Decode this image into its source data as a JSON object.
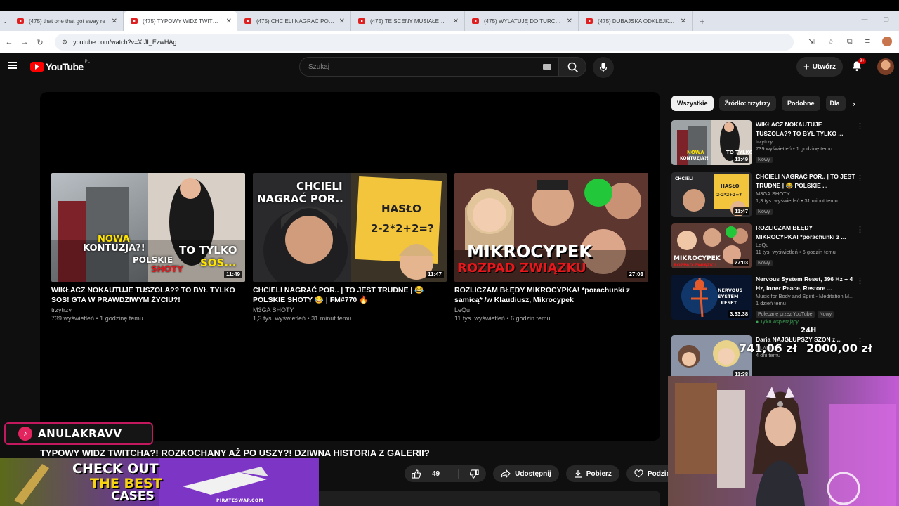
{
  "browser": {
    "tabs": [
      {
        "title": "(475) that one that got away re"
      },
      {
        "title": "(475) TYPOWY WIDZ TWITCHA"
      },
      {
        "title": "(475) CHCIELI NAGRAĆ POR.. |"
      },
      {
        "title": "(475) TE SCENY MUSIAŁEM WY"
      },
      {
        "title": "(475) WYLATUJĘ DO TURCJI - Y"
      },
      {
        "title": "(475) DUBAJSKA ODKLEJKA WI"
      }
    ],
    "url": "youtube.com/watch?v=XIJI_EzwHAg"
  },
  "youtube": {
    "logo_word": "YouTube",
    "logo_country": "PL",
    "search_placeholder": "Szukaj",
    "create_label": "Utwórz",
    "notif_count": "9+"
  },
  "endscreen": [
    {
      "title": "WIKŁACZ NOKAUTUJE TUSZOLA?? TO BYŁ TYLKO SOS! GTA W PRAWDZIWYM ŻYCIU?!",
      "channel": "trzytrzy",
      "meta": "739 wyświetleń • 1 godzinę temu",
      "duration": "11:49",
      "overlay": {
        "l1": "NOWA",
        "l2": "KONTUZJA?!",
        "l3": "POLSKIE",
        "l4": "SHOTY",
        "l5": "TO TYLKO",
        "l6": "SOS..."
      }
    },
    {
      "title": "CHCIELI NAGRAĆ POR.. | TO JEST TRUDNE | 😂 POLSKIE SHOTY 😂 | FM#770 🔥",
      "channel": "M3GA SHOTY",
      "meta": "1,3 tys. wyświetleń • 31 minut temu",
      "duration": "11:47",
      "overlay": {
        "l1": "CHCIELI",
        "l2": "NAGRAĆ POR..",
        "l3": "HASŁO",
        "l4": "2-2*2+2=?"
      }
    },
    {
      "title": "ROZLICZAM BŁĘDY MIKROCYPKA! *porachunki z samicą* /w Klaudiusz, Mikrocypek",
      "channel": "LeQu",
      "meta": "11 tys. wyświetleń • 6 godzin temu",
      "duration": "27:03",
      "overlay": {
        "l1": "MIKROCYPEK",
        "l2": "ROZPAD ZWIĄZKU"
      }
    }
  ],
  "video": {
    "title": "TYPOWY WIDZ TWITCHA?! ROZKOCHANY AŻ PO USZY?! DZIWNA HISTORIA Z GALERII?",
    "likes": "49",
    "share": "Udostępnij",
    "download": "Pobierz",
    "thanks": "Podziękuj"
  },
  "sidebar": {
    "chips": [
      "Wszystkie",
      "Źródło: trzytrzy",
      "Podobne",
      "Dla"
    ],
    "items": [
      {
        "title": "WIKŁACZ NOKAUTUJE TUSZOLA?? TO BYŁ TYLKO ...",
        "channel": "trzytrzy",
        "meta": "739 wyświetleń • 1 godzinę temu",
        "badge": "Nowy",
        "duration": "11:49"
      },
      {
        "title": "CHCIELI NAGRAĆ POR.. | TO JEST TRUDNE | 😂 POLSKIE ...",
        "channel": "M3GA SHOTY",
        "meta": "1,3 tys. wyświetleń • 31 minut temu",
        "badge": "Nowy",
        "duration": "11:47"
      },
      {
        "title": "ROZLICZAM BŁĘDY MIKROCYPKA! *porachunki z ...",
        "channel": "LeQu",
        "meta": "11 tys. wyświetleń • 6 godzin temu",
        "badge": "Nowy",
        "duration": "27:03"
      },
      {
        "title": "Nervous System Reset, 396 Hz + 4 Hz, Inner Peace, Restore ...",
        "channel": "Music for Body and Spirit - Meditation M...",
        "meta": "1 dzień temu",
        "badge": "Nowy",
        "promoted": "Polecane przez YouTube",
        "member": "Tylko wspierający",
        "duration": "3:33:38"
      },
      {
        "title": "Daria NAJGŁUPSZY SZON z ...",
        "channel": "GLADIUS",
        "meta": "4 dni temu",
        "duration": "11:38"
      }
    ]
  },
  "stream": {
    "goal_tag": "24H",
    "goal_current": "741,06 zł",
    "goal_target": "2000,00 zł",
    "tiktok_name": "ANULAKRAVV",
    "promo_line1": "CHECK OUT",
    "promo_line2": "THE BEST",
    "promo_line3": "CASES",
    "promo_site": "PIRATESWAP.COM"
  },
  "colors": {
    "yt_red": "#ff0000",
    "bg": "#0f0f0f",
    "pill": "#272727",
    "tiktok_border": "#c2195e"
  }
}
